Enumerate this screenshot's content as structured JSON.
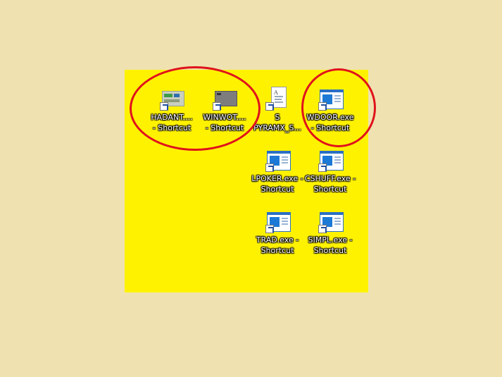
{
  "desktop": {
    "icons": [
      {
        "line1": "HADANT....",
        "line2": "- Shortcut",
        "icon": "folder-app-icon"
      },
      {
        "line1": "WINWOT....",
        "line2": "- Shortcut",
        "icon": "gray-window-icon"
      },
      {
        "line1": "S",
        "line2": "PYRAMX_S...",
        "icon": "document-icon"
      },
      {
        "line1": "WDOOR.exe",
        "line2": "- Shortcut",
        "icon": "exe-window-icon"
      },
      {
        "line1": "LPOKER.exe -",
        "line2": "Shortcut",
        "icon": "exe-window-icon"
      },
      {
        "line1": "CSHUFF.exe -",
        "line2": "Shortcut",
        "icon": "exe-window-icon"
      },
      {
        "line1": "TRAD.exe -",
        "line2": "Shortcut",
        "icon": "exe-window-icon"
      },
      {
        "line1": "SIMPL.exe -",
        "line2": "Shortcut",
        "icon": "exe-window-icon"
      }
    ]
  },
  "colors": {
    "desktop_bg": "#fff200",
    "page_bg": "#efe2b0",
    "annotation_ring": "#e0121c"
  }
}
